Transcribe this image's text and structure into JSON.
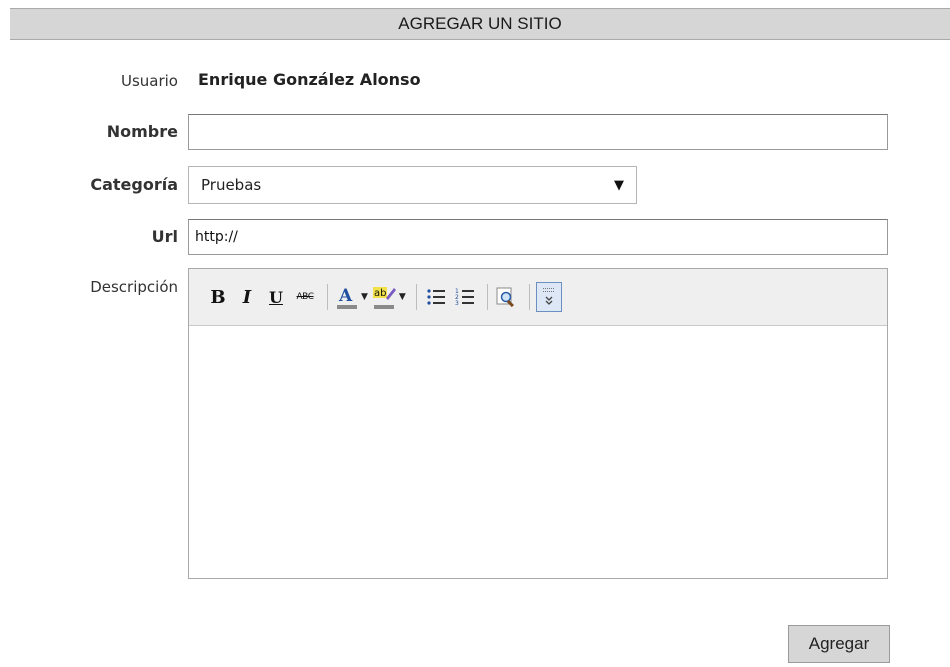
{
  "form": {
    "title": "AGREGAR UN SITIO",
    "user_label": "Usuario",
    "user_name": "Enrique González Alonso",
    "name_label": "Nombre",
    "name_value": "",
    "category_label": "Categoría",
    "category_selected": "Pruebas",
    "url_label": "Url",
    "url_value": "http://",
    "description_label": "Descripción",
    "submit_label": "Agregar"
  },
  "toolbar": {
    "bold": "B",
    "italic": "I",
    "underline": "U",
    "strike": "ABC",
    "font_color": "A",
    "highlight": "ab"
  },
  "colors": {
    "title_bar": "#d6d6d6",
    "toolbar_bg": "#efefef",
    "active_button_border": "#6b8fc0"
  }
}
